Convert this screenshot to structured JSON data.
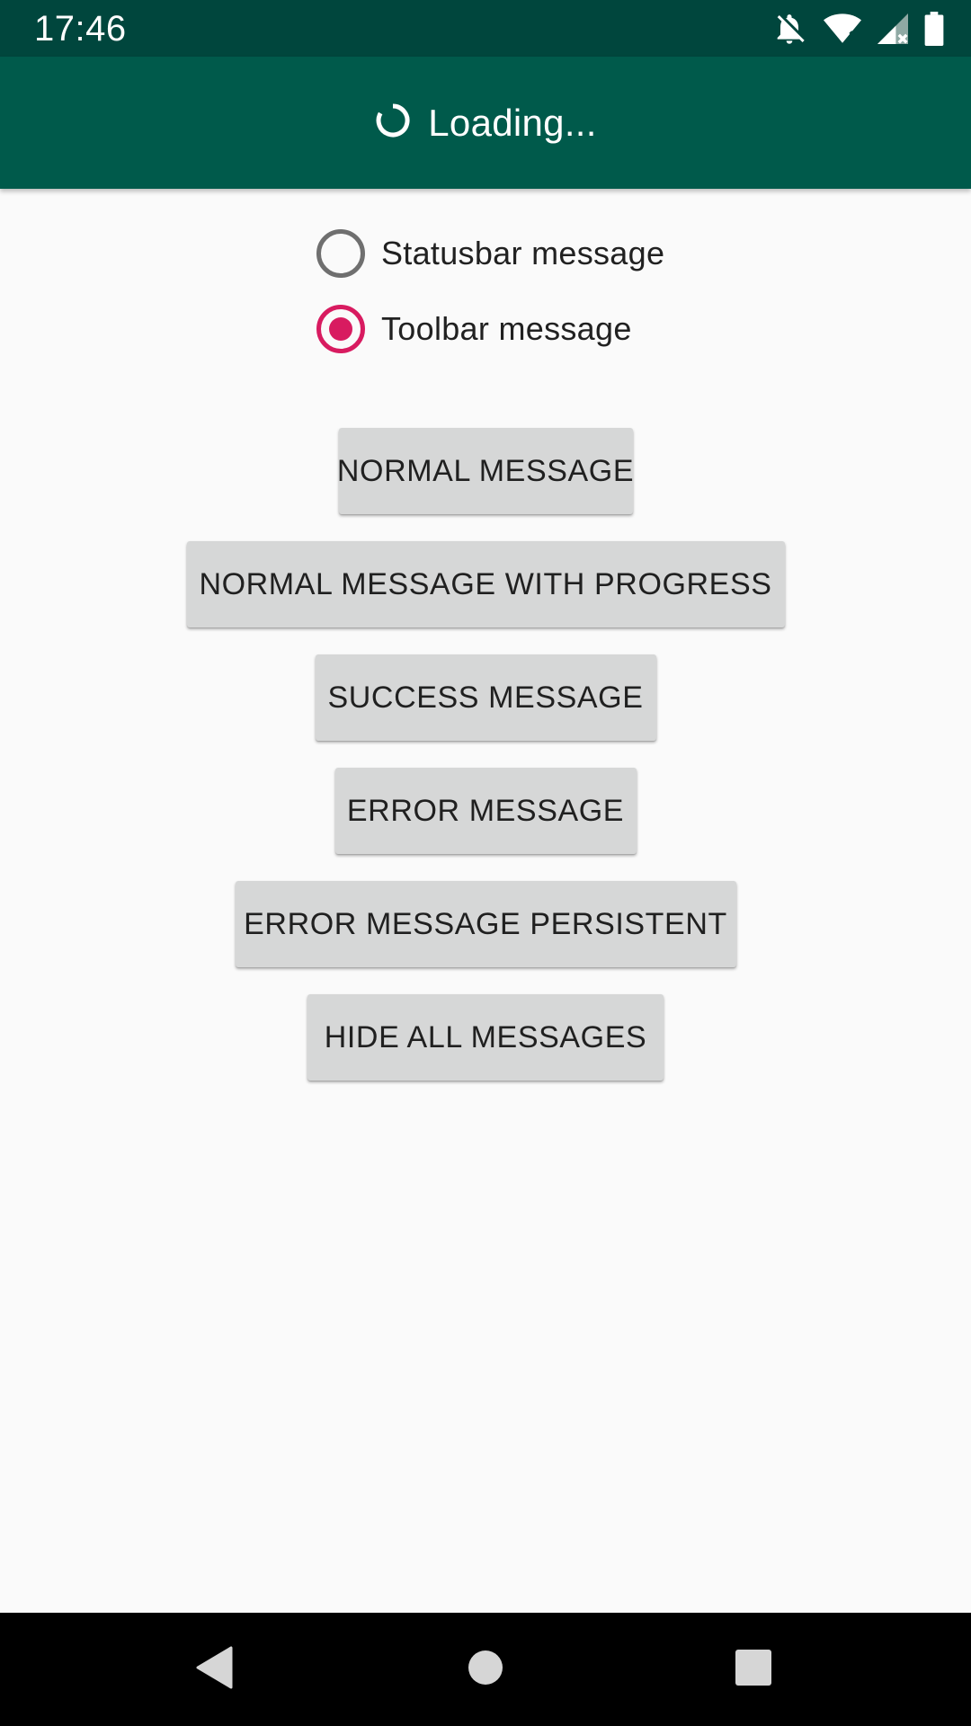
{
  "status_bar": {
    "time": "17:46",
    "icons": [
      "notifications-off-icon",
      "wifi-icon",
      "cellular-signal-icon",
      "battery-icon"
    ],
    "background": "#00463d"
  },
  "toolbar": {
    "title": "Loading...",
    "icon": "progress-spinner-icon",
    "background": "#005a4b"
  },
  "radio_group": {
    "options": [
      {
        "label": "Statusbar message",
        "checked": false
      },
      {
        "label": "Toolbar message",
        "checked": true
      }
    ],
    "accent_color": "#d81b60"
  },
  "buttons": {
    "normal_message": "NORMAL MESSAGE",
    "normal_message_with_progress": "NORMAL MESSAGE WITH PROGRESS",
    "success_message": "SUCCESS MESSAGE",
    "error_message": "ERROR MESSAGE",
    "error_message_persistent": "ERROR MESSAGE PERSISTENT",
    "hide_all_messages": "HIDE ALL MESSAGES"
  },
  "nav_bar": {
    "icons": [
      "back-icon",
      "home-icon",
      "recents-icon"
    ]
  }
}
